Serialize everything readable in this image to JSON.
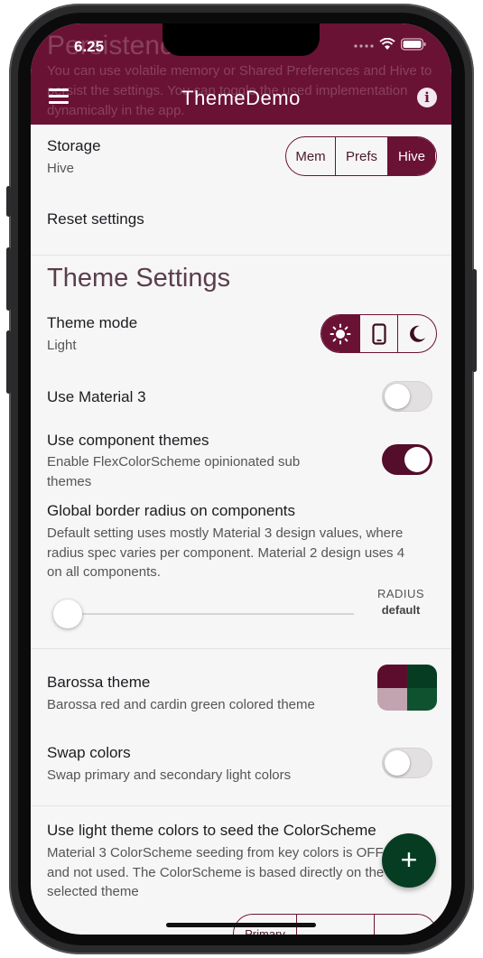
{
  "status": {
    "time": "6.25"
  },
  "ghost": {
    "title": "Persistence",
    "text": "You can use volatile memory or Shared Preferences and Hive to persist the settings. You can toggle the used implementation dynamically in the app."
  },
  "appbar": {
    "title": "ThemeDemo",
    "info_glyph": "i"
  },
  "storage": {
    "title": "Storage",
    "value": "Hive",
    "options": [
      "Mem",
      "Prefs",
      "Hive"
    ],
    "selected": "Hive"
  },
  "reset": {
    "label": "Reset settings"
  },
  "section": {
    "title": "Theme Settings"
  },
  "theme_mode": {
    "title": "Theme mode",
    "value": "Light",
    "selected": "light"
  },
  "material3": {
    "title": "Use Material 3",
    "enabled": false
  },
  "component_themes": {
    "title": "Use component themes",
    "subtitle": "Enable FlexColorScheme opinionated sub themes",
    "enabled": true
  },
  "radius": {
    "title": "Global border radius on components",
    "subtitle": "Default setting uses mostly Material 3 design values, where radius spec varies per component. Material 2 design uses 4 on all components.",
    "label": "RADIUS",
    "value": "default",
    "slider_fraction": 0.0
  },
  "barossa": {
    "title": "Barossa theme",
    "subtitle": "Barossa red and cardin green colored theme",
    "colors": [
      "#5c0d2d",
      "#063d22",
      "#c2a4b0",
      "#0e5230"
    ]
  },
  "swap": {
    "title": "Swap colors",
    "subtitle": "Swap primary and secondary light colors",
    "enabled": false
  },
  "seed": {
    "title": "Use light theme colors to seed the ColorScheme",
    "subtitle": "Material 3 ColorScheme seeding from key colors is OFF and not used. The ColorScheme is based directly on the selected theme",
    "partial_tab": "Primary"
  },
  "fab": {
    "glyph": "+"
  },
  "colors": {
    "primary": "#6a1234",
    "background": "#f7f6f7",
    "fab": "#063d22"
  }
}
